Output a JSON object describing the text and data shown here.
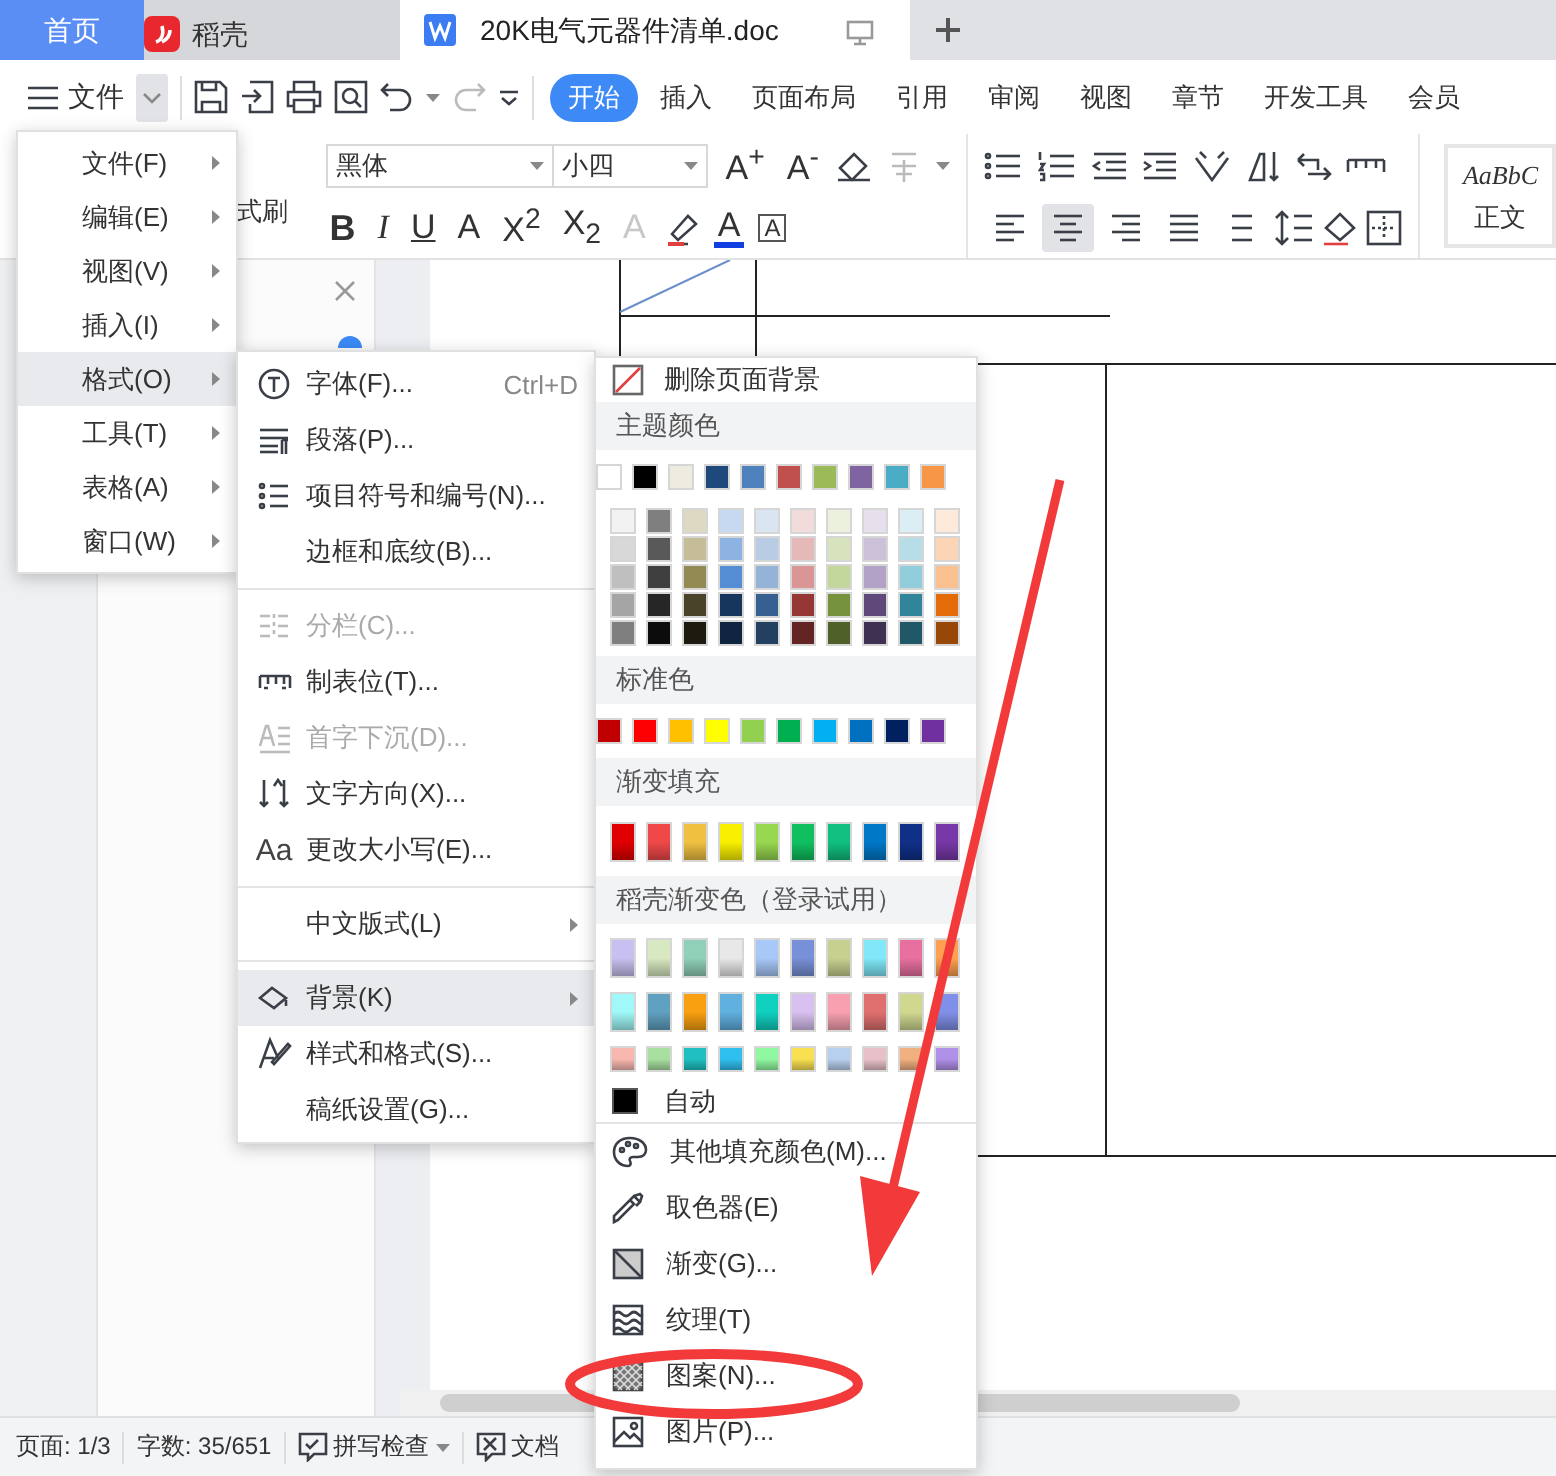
{
  "tabs": [
    {
      "kind": "home",
      "label": "首页",
      "selected": false
    },
    {
      "kind": "docer",
      "label": "稻壳",
      "selected": false
    },
    {
      "kind": "document",
      "label": "20K电气元器件清单.doc",
      "selected": true
    }
  ],
  "toolbar": {
    "menu_label": "文件"
  },
  "ribbon_tabs": [
    {
      "label": "开始",
      "selected": true
    },
    {
      "label": "插入",
      "selected": false
    },
    {
      "label": "页面布局",
      "selected": false
    },
    {
      "label": "引用",
      "selected": false
    },
    {
      "label": "审阅",
      "selected": false
    },
    {
      "label": "视图",
      "selected": false
    },
    {
      "label": "章节",
      "selected": false
    },
    {
      "label": "开发工具",
      "selected": false
    },
    {
      "label": "会员",
      "selected": false
    }
  ],
  "ribbon": {
    "format_painter": "式刷",
    "font": "黑体",
    "font_size": "小四",
    "size_buttons": [
      "A$^{+}$",
      "A$^{-}$"
    ],
    "format_buttons": [
      "B",
      "I",
      "U",
      "A",
      "X$^{2}$",
      "X$_{2}$",
      "A"
    ],
    "font_color_button": "A",
    "char_border_button": "A",
    "alignment": [
      {
        "selected": false
      },
      {
        "selected": true
      },
      {
        "selected": false
      },
      {
        "selected": false
      },
      {
        "selected": false
      }
    ],
    "style_sample": "AaBbC",
    "style_name": "正文"
  },
  "format_menu": [
    {
      "label": "文件(F)",
      "submenu": true,
      "selected": false
    },
    {
      "label": "编辑(E)",
      "submenu": true,
      "selected": false
    },
    {
      "label": "视图(V)",
      "submenu": true,
      "selected": false
    },
    {
      "label": "插入(I)",
      "submenu": true,
      "selected": false
    },
    {
      "label": "格式(O)",
      "submenu": true,
      "selected": true
    },
    {
      "label": "工具(T)",
      "submenu": true,
      "selected": false
    },
    {
      "label": "表格(A)",
      "submenu": true,
      "selected": false
    },
    {
      "label": "窗口(W)",
      "submenu": true,
      "selected": false
    }
  ],
  "format_submenu": [
    [
      {
        "label": "字体(F)...",
        "shortcut": "Ctrl+D",
        "disabled": false,
        "selected": false,
        "submenu": false
      },
      {
        "label": "段落(P)...",
        "disabled": false,
        "selected": false,
        "submenu": false
      },
      {
        "label": "项目符号和编号(N)...",
        "disabled": false,
        "selected": false,
        "submenu": false
      },
      {
        "label": "边框和底纹(B)...",
        "disabled": false,
        "selected": false,
        "submenu": false
      }
    ],
    [
      {
        "label": "分栏(C)...",
        "disabled": true,
        "selected": false,
        "submenu": false
      },
      {
        "label": "制表位(T)...",
        "disabled": false,
        "selected": false,
        "submenu": false
      },
      {
        "label": "首字下沉(D)...",
        "disabled": true,
        "selected": false,
        "submenu": false
      },
      {
        "label": "文字方向(X)...",
        "disabled": false,
        "selected": false,
        "submenu": false
      },
      {
        "label": "更改大小写(E)...",
        "glyph": "Aa",
        "disabled": false,
        "selected": false,
        "submenu": false
      }
    ],
    [
      {
        "label": "中文版式(L)",
        "disabled": false,
        "selected": false,
        "submenu": true
      }
    ],
    [
      {
        "label": "背景(K)",
        "disabled": false,
        "selected": true,
        "submenu": true
      },
      {
        "label": "样式和格式(S)...",
        "disabled": false,
        "selected": false,
        "submenu": false
      },
      {
        "label": "稿纸设置(G)...",
        "disabled": false,
        "selected": false,
        "submenu": false
      }
    ]
  ],
  "background_menu": {
    "remove": "删除页面背景",
    "theme_title": "主题颜色",
    "theme_colors": [
      {
        "color": "#ffffff"
      },
      {
        "color": "#000000"
      },
      {
        "color": "#eeece1"
      },
      {
        "color": "#1f497d"
      },
      {
        "color": "#4f81bd"
      },
      {
        "color": "#c0504d"
      },
      {
        "color": "#9bbb59"
      },
      {
        "color": "#8064a2"
      },
      {
        "color": "#4bacc6"
      },
      {
        "color": "#f79646"
      }
    ],
    "theme_shades": [
      [
        {
          "color": "#f2f2f2"
        },
        {
          "color": "#7f7f7f"
        },
        {
          "color": "#ddd9c3"
        },
        {
          "color": "#c6d9f0"
        },
        {
          "color": "#dbe5f1"
        },
        {
          "color": "#f2dcdb"
        },
        {
          "color": "#ebf1dd"
        },
        {
          "color": "#e5e0ec"
        },
        {
          "color": "#dbeef3"
        },
        {
          "color": "#fdeada"
        }
      ],
      [
        {
          "color": "#d8d8d8"
        },
        {
          "color": "#595959"
        },
        {
          "color": "#c4bd97"
        },
        {
          "color": "#8db3e2"
        },
        {
          "color": "#b8cce4"
        },
        {
          "color": "#e5b9b7"
        },
        {
          "color": "#d7e3bc"
        },
        {
          "color": "#ccc1d9"
        },
        {
          "color": "#b7dde8"
        },
        {
          "color": "#fbd5b5"
        }
      ],
      [
        {
          "color": "#bfbfbf"
        },
        {
          "color": "#3f3f3f"
        },
        {
          "color": "#938953"
        },
        {
          "color": "#548dd4"
        },
        {
          "color": "#95b3d7"
        },
        {
          "color": "#d99694"
        },
        {
          "color": "#c3d69b"
        },
        {
          "color": "#b2a2c7"
        },
        {
          "color": "#92cddc"
        },
        {
          "color": "#fac08f"
        }
      ],
      [
        {
          "color": "#a5a5a5"
        },
        {
          "color": "#262626"
        },
        {
          "color": "#494429"
        },
        {
          "color": "#17365d"
        },
        {
          "color": "#366092"
        },
        {
          "color": "#953734"
        },
        {
          "color": "#76923c"
        },
        {
          "color": "#5f497a"
        },
        {
          "color": "#31859b"
        },
        {
          "color": "#e36c09"
        }
      ],
      [
        {
          "color": "#7f7f7f"
        },
        {
          "color": "#0c0c0c"
        },
        {
          "color": "#1d1b10"
        },
        {
          "color": "#0f243e"
        },
        {
          "color": "#244061"
        },
        {
          "color": "#632423"
        },
        {
          "color": "#4f6128"
        },
        {
          "color": "#3f3151"
        },
        {
          "color": "#205867"
        },
        {
          "color": "#974806"
        }
      ]
    ],
    "standard_title": "标准色",
    "standard_colors": [
      {
        "color": "#c00000"
      },
      {
        "color": "#ff0000"
      },
      {
        "color": "#ffc000"
      },
      {
        "color": "#ffff00"
      },
      {
        "color": "#92d050"
      },
      {
        "color": "#00b050"
      },
      {
        "color": "#00b0f0"
      },
      {
        "color": "#0070c0"
      },
      {
        "color": "#002060"
      },
      {
        "color": "#7030a0"
      }
    ],
    "gradient_title": "渐变填充",
    "gradient_colors": [
      {
        "color": "#e00000"
      },
      {
        "color": "#f04848"
      },
      {
        "color": "#f0c040"
      },
      {
        "color": "#f8f000"
      },
      {
        "color": "#98d850"
      },
      {
        "color": "#10c060"
      },
      {
        "color": "#10c080"
      },
      {
        "color": "#0078c8"
      },
      {
        "color": "#103088"
      },
      {
        "color": "#7838a8"
      }
    ],
    "docer_title": "稻壳渐变色（登录试用）",
    "docer_gradients": [
      [
        {
          "color": "#c8c0f0"
        },
        {
          "color": "#d8e8c0"
        },
        {
          "color": "#90d0b8"
        },
        {
          "color": "#e8e8e8"
        },
        {
          "color": "#a8c8f8"
        },
        {
          "color": "#7890d8"
        },
        {
          "color": "#c8d090"
        },
        {
          "color": "#80e8f8"
        },
        {
          "color": "#e870a0"
        },
        {
          "color": "#ffa050"
        }
      ],
      [
        {
          "color": "#a0f8f8"
        },
        {
          "color": "#60a0c0"
        },
        {
          "color": "#f8a010"
        },
        {
          "color": "#60b0e0"
        },
        {
          "color": "#10d0c0"
        },
        {
          "color": "#d8c0f0"
        },
        {
          "color": "#f8a0b0"
        },
        {
          "color": "#e07070"
        },
        {
          "color": "#d0d890"
        },
        {
          "color": "#8090e8"
        }
      ],
      [
        {
          "color": "#f8b8b0"
        },
        {
          "color": "#a8e0a0"
        },
        {
          "color": "#20c0c0"
        },
        {
          "color": "#30c0f0"
        },
        {
          "color": "#90f8a0"
        },
        {
          "color": "#f8e050"
        },
        {
          "color": "#b8d0f0"
        },
        {
          "color": "#e8c0c8"
        },
        {
          "color": "#f0b080"
        },
        {
          "color": "#b090e8"
        }
      ]
    ],
    "auto": {
      "label": "自动",
      "color": "#000000"
    },
    "actions": [
      {
        "label": "其他填充颜色(M)..."
      },
      {
        "label": "取色器(E)"
      },
      {
        "label": "渐变(G)..."
      },
      {
        "label": "纹理(T)"
      },
      {
        "label": "图案(N)..."
      },
      {
        "label": "图片(P)..."
      }
    ]
  },
  "status_bar": {
    "page": "页面: 1/3",
    "words": "字数: 35/651",
    "spell_check": "拼写检查",
    "doc_check": "文档"
  }
}
